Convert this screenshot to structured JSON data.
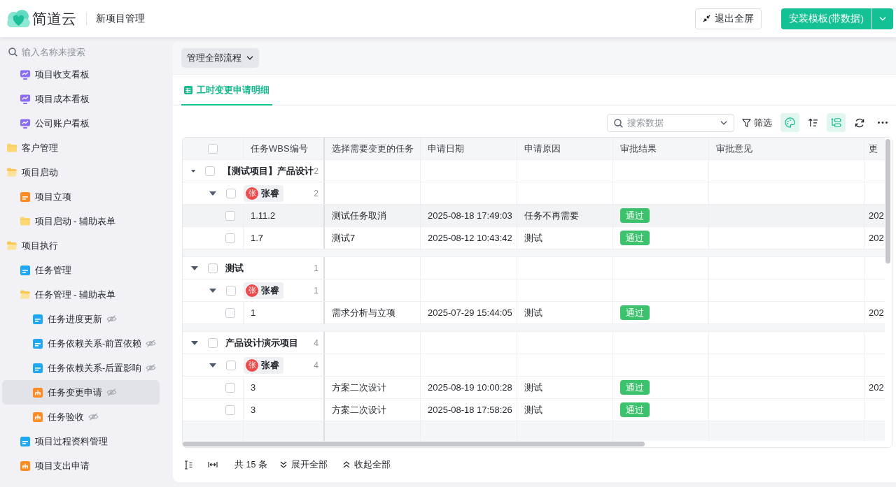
{
  "header": {
    "logo": "简道云",
    "app_name": "新项目管理",
    "exit_fullscreen": "退出全屏",
    "install": "安装模板(带数据)"
  },
  "sidebar": {
    "search_placeholder": "输入名称来搜索",
    "tree": [
      {
        "children": [
          {
            "label": "项目收支看板",
            "kind": "dashboard",
            "hidden": false,
            "selected": false
          },
          {
            "label": "项目成本看板",
            "kind": "dashboard",
            "hidden": false,
            "selected": false
          },
          {
            "label": "公司账户看板",
            "kind": "dashboard",
            "hidden": false,
            "selected": false
          }
        ]
      },
      {
        "label": "客户管理",
        "kind": "folder",
        "expanded": false,
        "hidden": false,
        "selected": false
      },
      {
        "label": "项目启动",
        "kind": "folder",
        "expanded": true,
        "hidden": false,
        "selected": false,
        "children": [
          {
            "label": "项目立项",
            "kind": "form",
            "color": "#ff8a1f",
            "hidden": false,
            "selected": false
          },
          {
            "label": "项目启动 - 辅助表单",
            "kind": "folder",
            "expanded": false,
            "hidden": false,
            "selected": false
          }
        ]
      },
      {
        "label": "项目执行",
        "kind": "folder",
        "expanded": true,
        "hidden": false,
        "selected": false,
        "children": [
          {
            "label": "任务管理",
            "kind": "form",
            "color": "#1ea7f2",
            "hidden": false,
            "selected": false
          },
          {
            "label": "任务管理 - 辅助表单",
            "kind": "folder",
            "expanded": true,
            "hidden": false,
            "selected": false,
            "children": [
              {
                "label": "任务进度更新",
                "kind": "form",
                "color": "#1ea7f2",
                "hidden": true,
                "selected": false
              },
              {
                "label": "任务依赖关系-前置依赖",
                "kind": "form",
                "color": "#1ea7f2",
                "hidden": true,
                "selected": false
              },
              {
                "label": "任务依赖关系-后置影响",
                "kind": "form",
                "color": "#1ea7f2",
                "hidden": true,
                "selected": false
              },
              {
                "label": "任务变更申请",
                "kind": "flow",
                "hidden": true,
                "selected": true
              },
              {
                "label": "任务验收",
                "kind": "flow",
                "hidden": true,
                "selected": false
              }
            ]
          },
          {
            "label": "项目过程资料管理",
            "kind": "form",
            "color": "#1ea7f2",
            "hidden": false,
            "selected": false
          },
          {
            "label": "项目支出申请",
            "kind": "flow",
            "hidden": false,
            "selected": false
          }
        ]
      }
    ]
  },
  "main": {
    "flow_menu": "管理全部流程",
    "tabs": [
      {
        "label": "工时变更申请明细",
        "selected": true
      }
    ],
    "search_placeholder": "搜索数据",
    "filter": "筛选",
    "tools": [
      {
        "kind": "format",
        "on": true
      },
      {
        "kind": "sort",
        "on": false
      },
      {
        "kind": "group",
        "on": true
      },
      {
        "kind": "refresh",
        "on": false
      },
      {
        "kind": "more",
        "on": false
      }
    ]
  },
  "table": {
    "all_checked": false,
    "columns": [
      "任务WBS编号",
      "选择需要变更的任务",
      "申请日期",
      "申请原因",
      "审批结果",
      "审批意见",
      "更"
    ],
    "groups": [
      {
        "label": "【测试项目】产品设计",
        "count": "2",
        "expanded": true,
        "checked": false,
        "subgroups": [
          {
            "avatar": "张",
            "name": "张睿",
            "count": "2",
            "expanded": true,
            "checked": false,
            "rows": [
              {
                "checked": false,
                "highlighted": true,
                "wbs": "1.11.2",
                "task": "测试任务取消",
                "date": "2025-08-18 17:49:03",
                "reason": "任务不再需要",
                "result": "通过",
                "column_8": "202"
              },
              {
                "checked": false,
                "highlighted": false,
                "wbs": "1.7",
                "task": "测试7",
                "date": "2025-08-12 10:43:42",
                "reason": "测试",
                "result": "通过",
                "column_8": "202"
              }
            ]
          }
        ]
      },
      {
        "label": "测试",
        "count": "1",
        "expanded": true,
        "checked": false,
        "subgroups": [
          {
            "avatar": "张",
            "name": "张睿",
            "count": "1",
            "expanded": true,
            "checked": false,
            "rows": [
              {
                "checked": false,
                "highlighted": false,
                "wbs": "1",
                "task": "需求分析与立项",
                "date": "2025-07-29 15:44:05",
                "reason": "测试",
                "result": "通过",
                "column_8": "202"
              }
            ]
          }
        ]
      },
      {
        "label": "产品设计演示项目",
        "count": "4",
        "expanded": true,
        "checked": false,
        "subgroups": [
          {
            "avatar": "张",
            "name": "张睿",
            "count": "4",
            "expanded": true,
            "checked": false,
            "rows": [
              {
                "checked": false,
                "highlighted": false,
                "wbs": "3",
                "task": "方案二次设计",
                "date": "2025-08-19 10:00:28",
                "reason": "测试",
                "result": "通过",
                "column_8": "202"
              },
              {
                "checked": false,
                "highlighted": false,
                "wbs": "3",
                "task": "方案二次设计",
                "date": "2025-08-18 17:58:26",
                "reason": "测试",
                "result": "通过"
              }
            ]
          }
        ]
      }
    ]
  },
  "footer": {
    "total": "共 15 条",
    "expand_all": "展开全部",
    "collapse_all": "收起全部"
  }
}
